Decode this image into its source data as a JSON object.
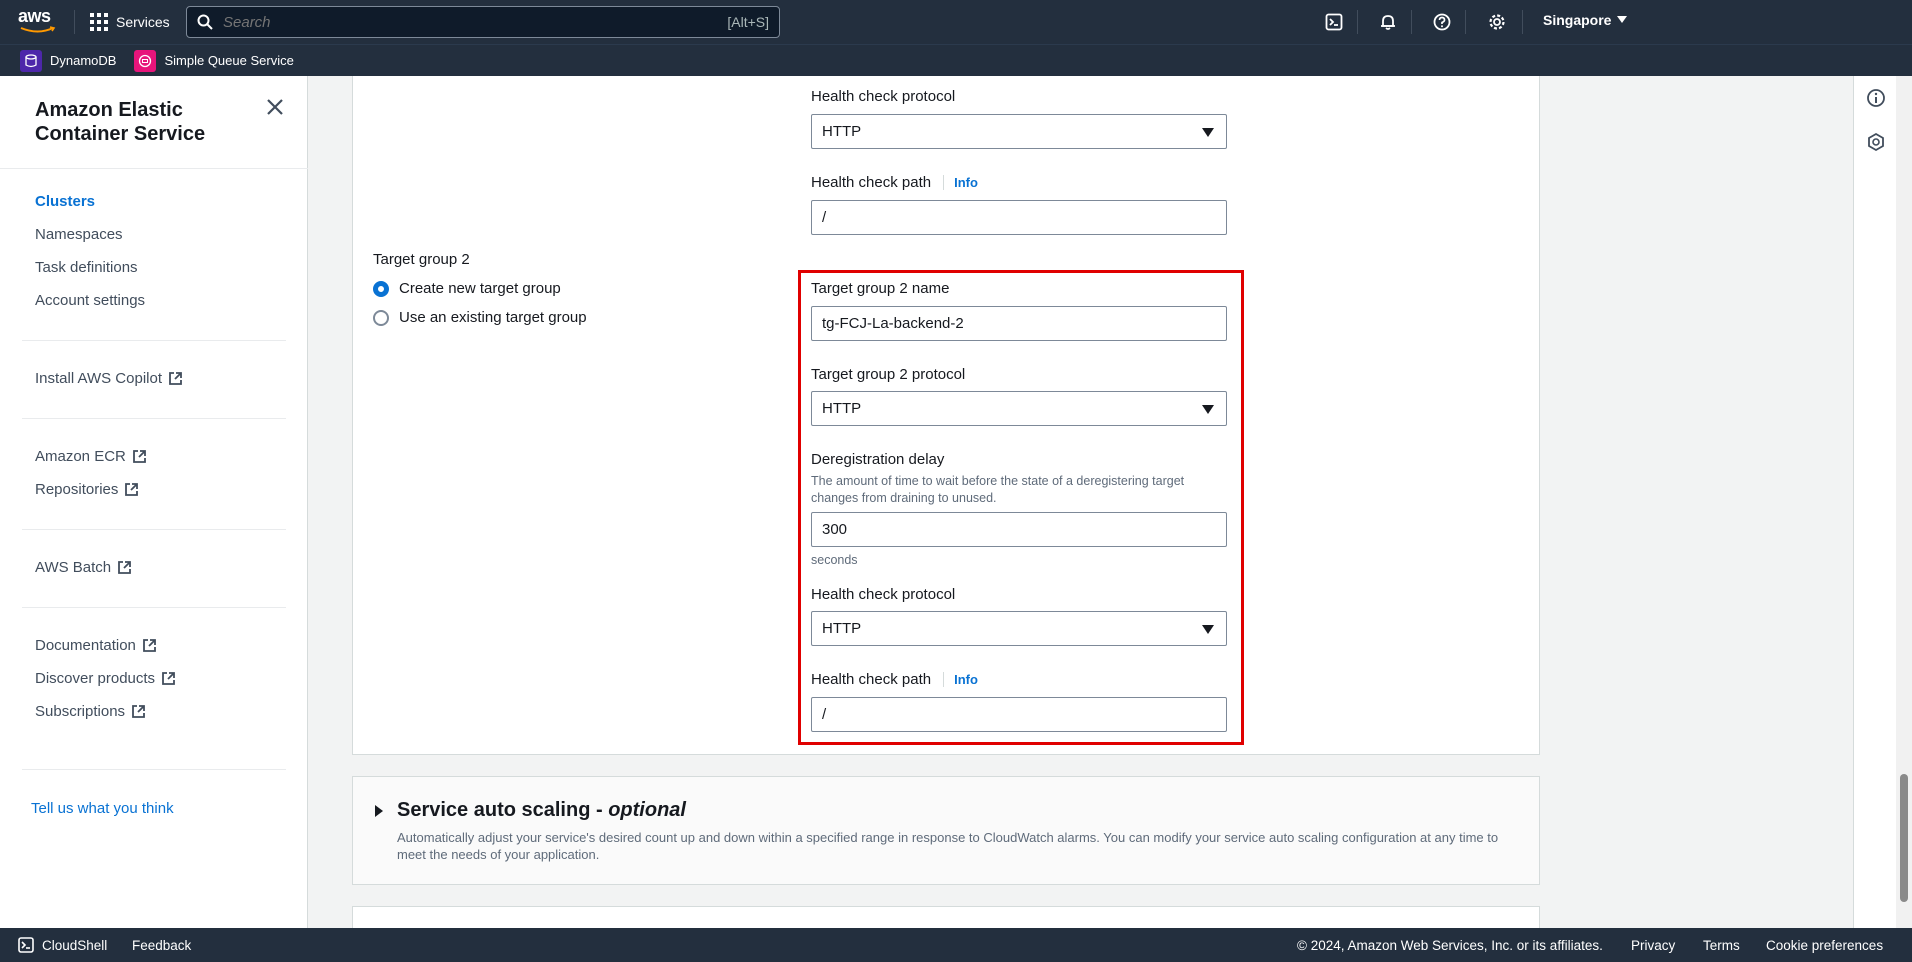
{
  "topnav": {
    "logo_text": "aws",
    "services_label": "Services",
    "search_placeholder": "Search",
    "search_shortcut": "[Alt+S]",
    "region": "Singapore",
    "icons": [
      "cloudshell-icon",
      "bell-icon",
      "help-icon",
      "gear-icon"
    ]
  },
  "favorites": [
    {
      "label": "DynamoDB",
      "color": "#4d27aa"
    },
    {
      "label": "Simple Queue Service",
      "color": "#e7157b"
    }
  ],
  "sidebar": {
    "title": "Amazon Elastic Container Service",
    "nav1": [
      {
        "label": "Clusters",
        "active": true
      },
      {
        "label": "Namespaces"
      },
      {
        "label": "Task definitions"
      },
      {
        "label": "Account settings"
      }
    ],
    "copilot": "Install AWS Copilot",
    "ecr": "Amazon ECR",
    "repositories": "Repositories",
    "batch": "AWS Batch",
    "documentation": "Documentation",
    "discover": "Discover products",
    "subscriptions": "Subscriptions",
    "feedback": "Tell us what you think"
  },
  "tg1": {
    "health_protocol_label": "Health check protocol",
    "health_protocol_value": "HTTP",
    "health_path_label": "Health check path",
    "health_path_value": "/",
    "info": "Info"
  },
  "tg2": {
    "section_label": "Target group 2",
    "radio_create": "Create new target group",
    "radio_existing": "Use an existing target group",
    "name_label": "Target group 2 name",
    "name_value": "tg-FCJ-La-backend-2",
    "protocol_label": "Target group 2 protocol",
    "protocol_value": "HTTP",
    "dereg_label": "Deregistration delay",
    "dereg_hint": "The amount of time to wait before the state of a deregistering target changes from draining to unused.",
    "dereg_value": "300",
    "dereg_unit": "seconds",
    "health_protocol_label": "Health check protocol",
    "health_protocol_value": "HTTP",
    "health_path_label": "Health check path",
    "health_path_value": "/",
    "info": "Info"
  },
  "autoscaling": {
    "title": "Service auto scaling - ",
    "title_optional": "optional",
    "description": "Automatically adjust your service's desired count up and down within a specified range in response to CloudWatch alarms. You can modify your service auto scaling configuration at any time to meet the needs of your application."
  },
  "bottombar": {
    "cloudshell": "CloudShell",
    "feedback": "Feedback",
    "copyright": "© 2024, Amazon Web Services, Inc. or its affiliates.",
    "privacy": "Privacy",
    "terms": "Terms",
    "cookies": "Cookie preferences"
  }
}
